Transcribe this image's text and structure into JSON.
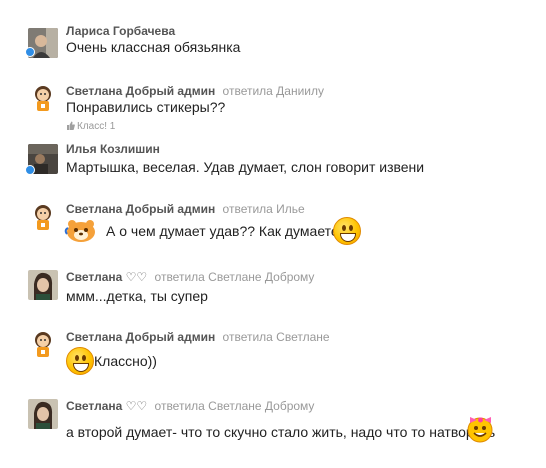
{
  "comments": [
    {
      "author": "Лариса Горбачева",
      "reply_to": "",
      "text": "Очень классная обязьянка",
      "online": true,
      "avatar_icon": "user-photo-woman"
    },
    {
      "author": "Светлана Добрый админ",
      "reply_to": "ответила Даниилу",
      "text": "Понравились стикеры??",
      "likes": "Класс! 1",
      "online": false,
      "avatar_icon": "cartoon-girl-avatar"
    },
    {
      "author": "Илья Козлишин",
      "reply_to": "",
      "text": "Мартышка, веселая. Удав думает, слон говорит извени",
      "online": true,
      "avatar_icon": "user-photo-man"
    },
    {
      "author": "Светлана Добрый админ",
      "reply_to": "ответила Илье",
      "text": "А о чем думает удав?? Как думаете??",
      "online": false,
      "avatar_icon": "cartoon-girl-avatar"
    },
    {
      "author": "Светлана ♡♡",
      "reply_to": "ответила Светлане Доброму",
      "text": "ммм...детка, ты супер",
      "online": false,
      "avatar_icon": "user-photo-woman-dark"
    },
    {
      "author": "Светлана Добрый админ",
      "reply_to": "ответила Светлане",
      "text": "Классно))",
      "online": false,
      "avatar_icon": "cartoon-girl-avatar"
    },
    {
      "author": "Светлана ♡♡",
      "reply_to": "ответила Светлане Доброму",
      "text": "а второй думает- что то скучно стало жить, надо что то натворить",
      "online": false,
      "avatar_icon": "user-photo-woman-dark"
    }
  ],
  "colors": {
    "author": "#555555",
    "reply": "#999999",
    "online_dot": "#2f8ee6"
  }
}
